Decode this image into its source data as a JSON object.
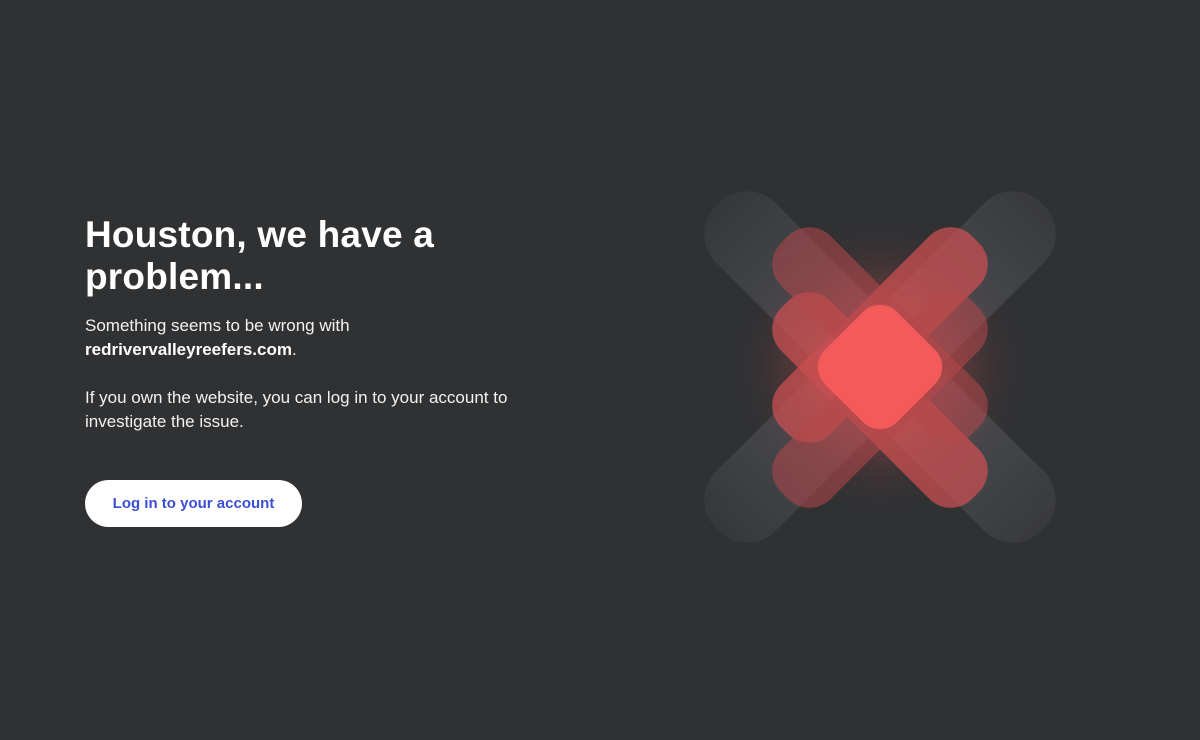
{
  "error_page": {
    "headline": "Houston, we have a problem...",
    "message_prefix": "Something seems to be wrong with",
    "domain": "redrivervalleyreefers.com",
    "message_suffix": ".",
    "owner_hint": "If you own the website, you can log in to your account to investigate the issue.",
    "login_button_label": "Log in to your account",
    "illustration_icon": "error-x-icon"
  },
  "colors": {
    "background": "#303133",
    "text": "#ffffff",
    "button_background": "#ffffff",
    "button_text": "#3b4fd6",
    "accent_red": "#f55a5a",
    "bar_grey": "#4a4c52"
  }
}
